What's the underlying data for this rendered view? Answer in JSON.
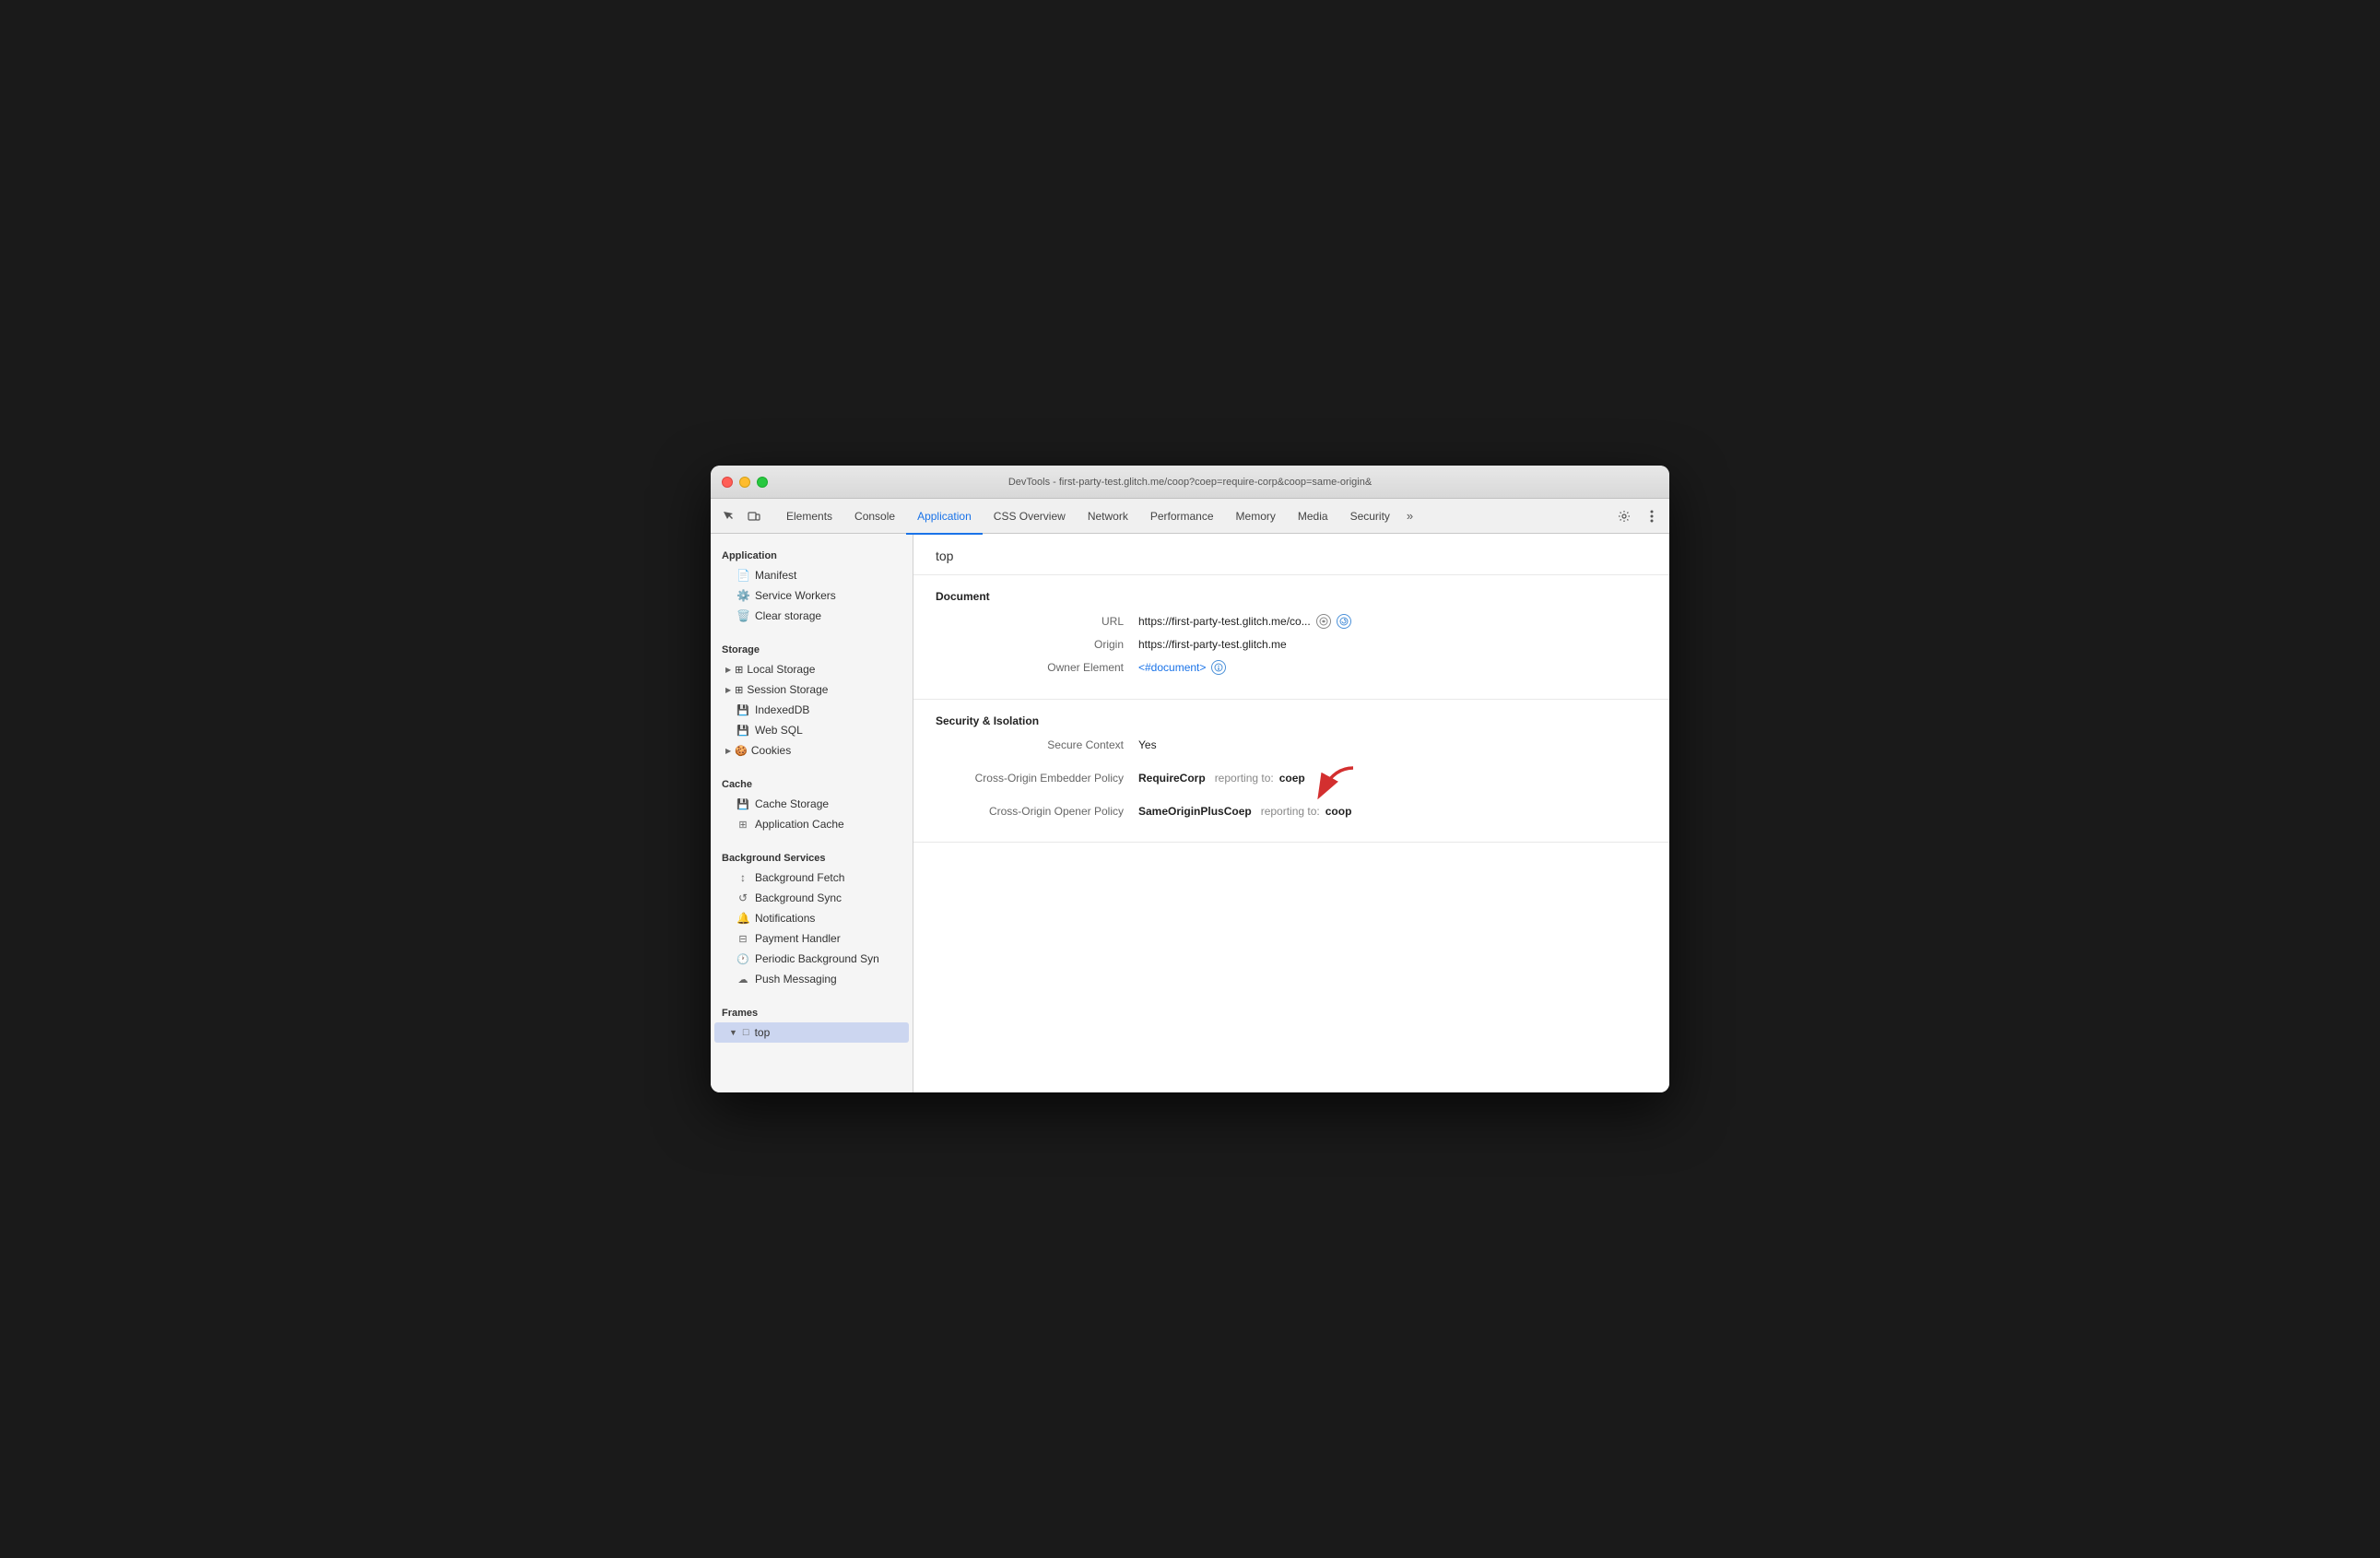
{
  "window": {
    "title": "DevTools - first-party-test.glitch.me/coop?coep=require-corp&coop=same-origin&"
  },
  "tabs": [
    {
      "id": "elements",
      "label": "Elements",
      "active": false
    },
    {
      "id": "console",
      "label": "Console",
      "active": false
    },
    {
      "id": "application",
      "label": "Application",
      "active": true
    },
    {
      "id": "css-overview",
      "label": "CSS Overview",
      "active": false
    },
    {
      "id": "network",
      "label": "Network",
      "active": false
    },
    {
      "id": "performance",
      "label": "Performance",
      "active": false
    },
    {
      "id": "memory",
      "label": "Memory",
      "active": false
    },
    {
      "id": "media",
      "label": "Media",
      "active": false
    },
    {
      "id": "security",
      "label": "Security",
      "active": false
    }
  ],
  "sidebar": {
    "sections": [
      {
        "id": "application",
        "label": "Application",
        "items": [
          {
            "id": "manifest",
            "label": "Manifest",
            "icon": "📄"
          },
          {
            "id": "service-workers",
            "label": "Service Workers",
            "icon": "⚙️"
          },
          {
            "id": "clear-storage",
            "label": "Clear storage",
            "icon": "🗑️"
          }
        ]
      },
      {
        "id": "storage",
        "label": "Storage",
        "items": [
          {
            "id": "local-storage",
            "label": "Local Storage",
            "icon": "▶",
            "expandable": true
          },
          {
            "id": "session-storage",
            "label": "Session Storage",
            "icon": "▶",
            "expandable": true
          },
          {
            "id": "indexeddb",
            "label": "IndexedDB",
            "icon": "💾"
          },
          {
            "id": "web-sql",
            "label": "Web SQL",
            "icon": "💾"
          },
          {
            "id": "cookies",
            "label": "Cookies",
            "icon": "▶",
            "expandable": true
          }
        ]
      },
      {
        "id": "cache",
        "label": "Cache",
        "items": [
          {
            "id": "cache-storage",
            "label": "Cache Storage",
            "icon": "💾"
          },
          {
            "id": "application-cache",
            "label": "Application Cache",
            "icon": "⊞"
          }
        ]
      },
      {
        "id": "background-services",
        "label": "Background Services",
        "items": [
          {
            "id": "background-fetch",
            "label": "Background Fetch",
            "icon": "↕"
          },
          {
            "id": "background-sync",
            "label": "Background Sync",
            "icon": "↺"
          },
          {
            "id": "notifications",
            "label": "Notifications",
            "icon": "🔔"
          },
          {
            "id": "payment-handler",
            "label": "Payment Handler",
            "icon": "⊟"
          },
          {
            "id": "periodic-bg-sync",
            "label": "Periodic Background Syn",
            "icon": "🕐"
          },
          {
            "id": "push-messaging",
            "label": "Push Messaging",
            "icon": "☁"
          }
        ]
      },
      {
        "id": "frames",
        "label": "Frames",
        "items": [
          {
            "id": "top-frame",
            "label": "top",
            "icon": "▼",
            "active": true
          }
        ]
      }
    ]
  },
  "panel": {
    "top_label": "top",
    "document_section": {
      "title": "Document",
      "rows": [
        {
          "label": "URL",
          "value": "https://first-party-test.glitch.me/co...",
          "is_link": false,
          "has_icons": true
        },
        {
          "label": "Origin",
          "value": "https://first-party-test.glitch.me",
          "is_link": false,
          "has_icons": false
        },
        {
          "label": "Owner Element",
          "value": "<#document>",
          "is_link": true,
          "has_icons": true
        }
      ]
    },
    "security_section": {
      "title": "Security & Isolation",
      "rows": [
        {
          "label": "Secure Context",
          "value": "Yes",
          "extra": null
        },
        {
          "label": "Cross-Origin Embedder Policy",
          "value": "RequireCorp",
          "reporting_label": "reporting to:",
          "reporting_value": "coep",
          "has_arrow": true
        },
        {
          "label": "Cross-Origin Opener Policy",
          "value": "SameOriginPlusCoep",
          "reporting_label": "reporting to:",
          "reporting_value": "coop",
          "has_arrow": false
        }
      ]
    }
  }
}
